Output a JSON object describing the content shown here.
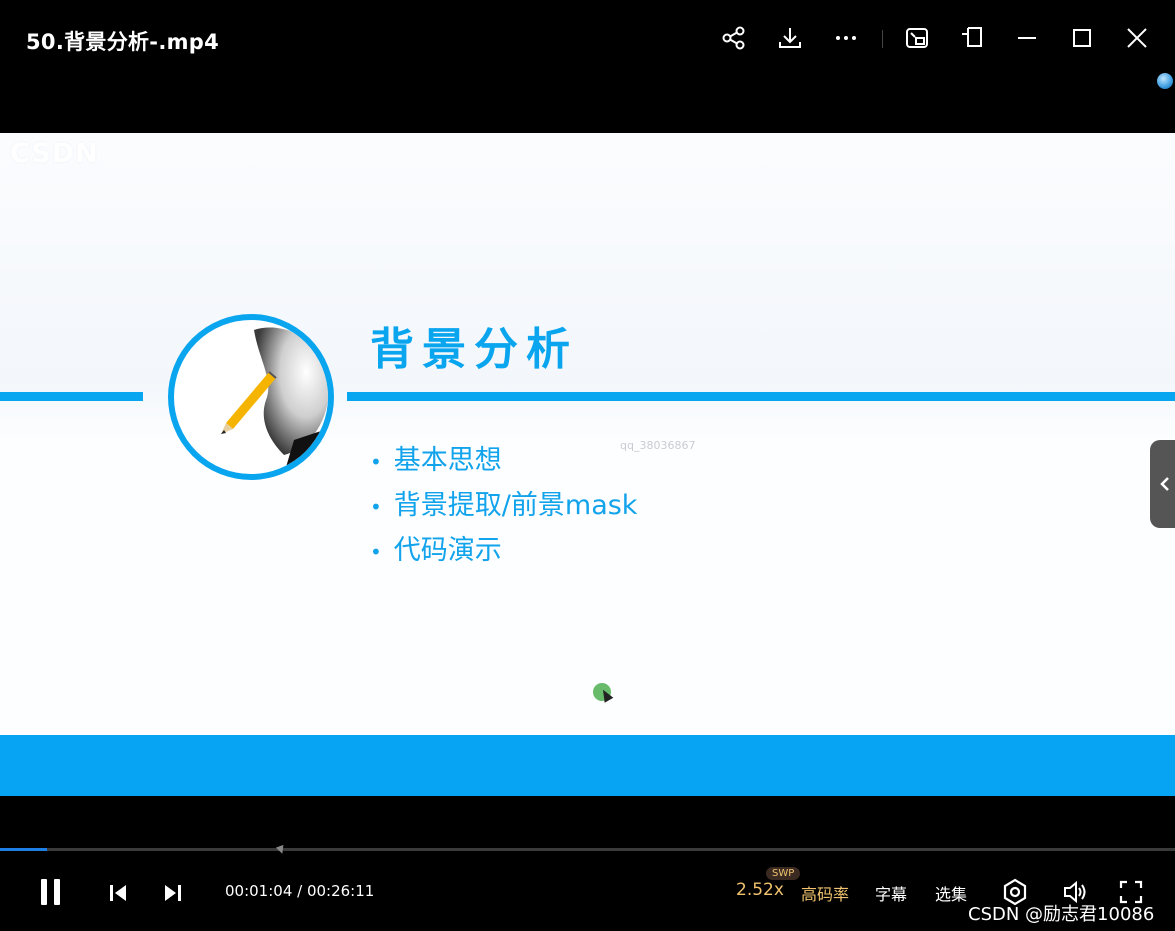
{
  "window": {
    "title": "50.背景分析-.mp4"
  },
  "toolbar": {
    "icons": [
      "share-icon",
      "download-icon",
      "more-icon",
      "picture-in-picture-icon",
      "pin-window-icon",
      "minimize-icon",
      "maximize-icon",
      "close-icon"
    ]
  },
  "slide": {
    "watermark": "CSDN",
    "heading": "背景分析",
    "bullets": [
      "基本思想",
      "背景提取/前景mask",
      "代码演示"
    ],
    "bullet_glyph": "•",
    "overlay_user": "qq_38036867",
    "accent": "#08a5f1"
  },
  "player": {
    "progress": 0.04,
    "time": "00:01:04 / 00:26:11",
    "speed": "2.52x",
    "swp_badge": "SWP",
    "quality": "高码率",
    "subtitles": "字幕",
    "episodes": "选集"
  },
  "footer": {
    "brand": "CSDN @励志君10086"
  }
}
